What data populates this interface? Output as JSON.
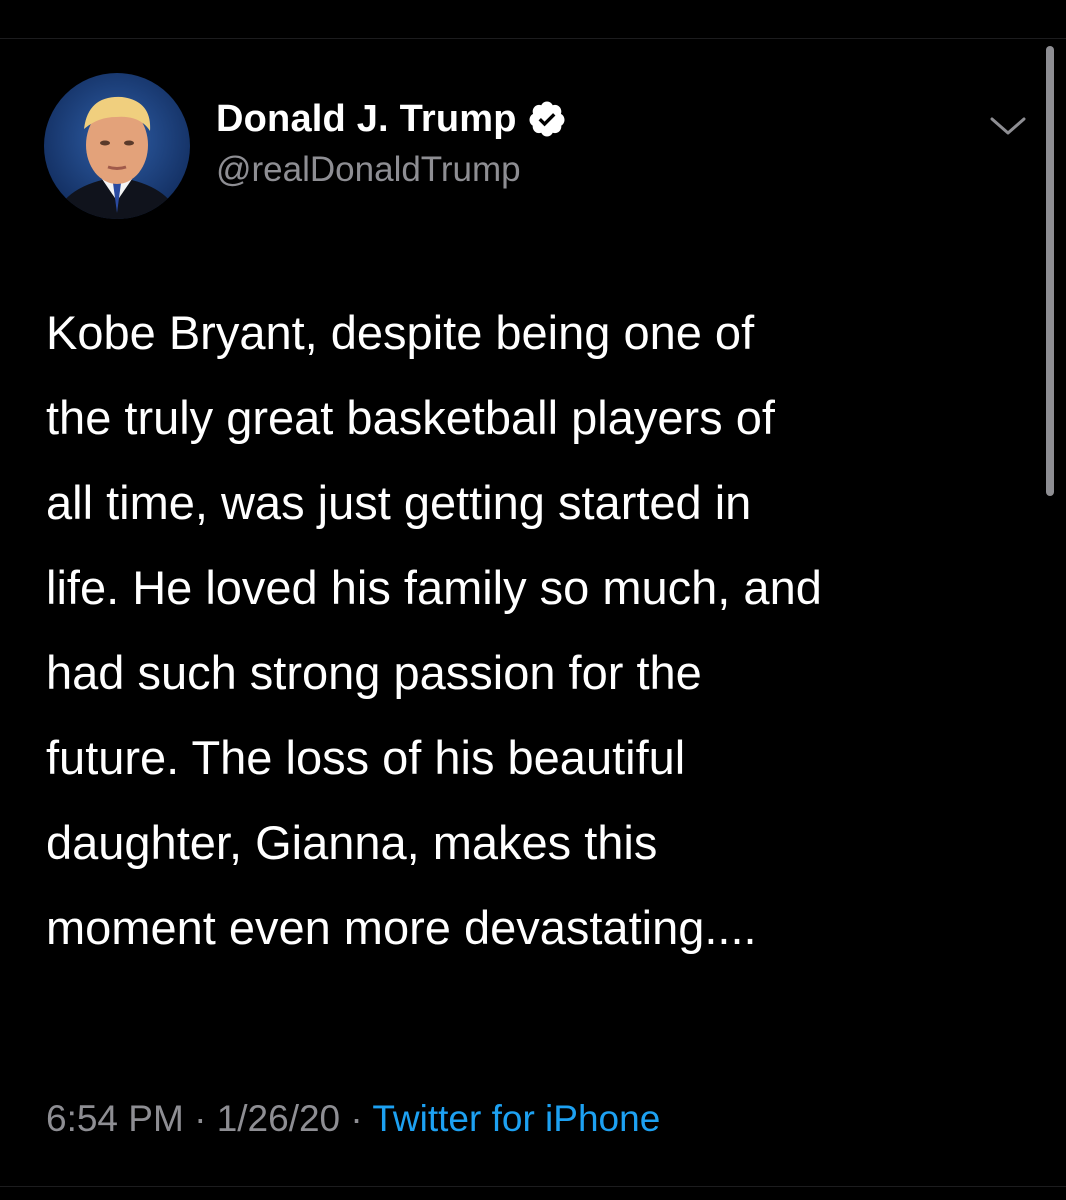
{
  "tweet": {
    "author": {
      "display_name": "Donald J. Trump",
      "handle": "@realDonaldTrump",
      "verified": true,
      "avatar_icon": "profile-photo"
    },
    "text": "Kobe Bryant, despite being one of\nthe truly great basketball players of\nall time, was just getting started in\nlife. He loved his family so much, and\nhad such strong passion for the\nfuture. The loss of his beautiful\ndaughter, Gianna, makes this\nmoment even more devastating....",
    "meta": {
      "time": "6:54 PM",
      "separator": " · ",
      "date": "1/26/20",
      "source": "Twitter for iPhone"
    },
    "menu_icon": "chevron-down-icon"
  },
  "colors": {
    "background": "#000000",
    "primary_text": "#ffffff",
    "secondary_text": "#8e8e93",
    "link": "#1da1f2",
    "verified_badge": "#ffffff"
  }
}
